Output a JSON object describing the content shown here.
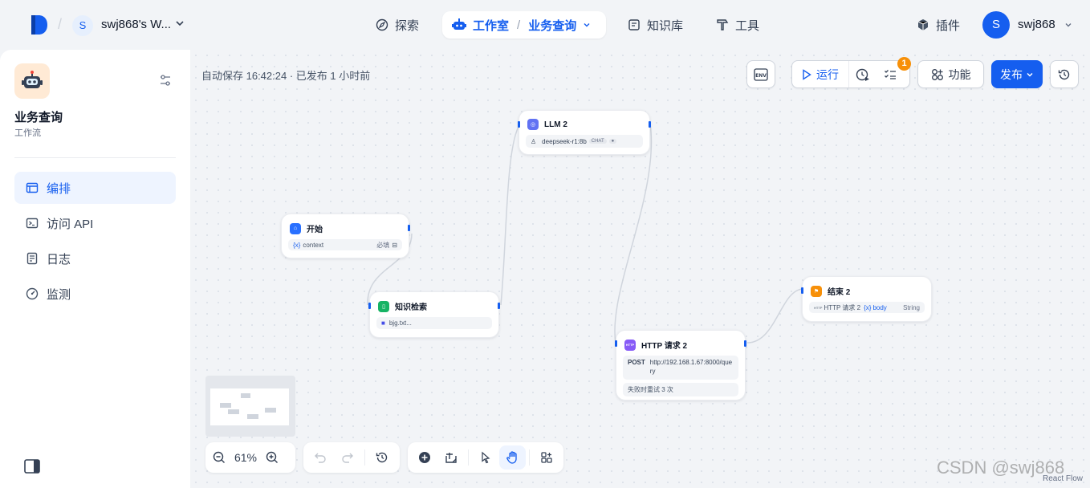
{
  "header": {
    "workspace_initial": "S",
    "workspace_name": "swj868's W...",
    "nav": {
      "explore": "探索",
      "studio": "工作室",
      "studio_sep": "/",
      "current_app": "业务查询",
      "knowledge": "知识库",
      "tools": "工具"
    },
    "plugin": "插件",
    "user_initial": "S",
    "user_name": "swj868"
  },
  "sidebar": {
    "app_name": "业务查询",
    "app_type": "工作流",
    "items": [
      {
        "label": "编排",
        "icon": "layout-icon",
        "active": true
      },
      {
        "label": "访问 API",
        "icon": "terminal-icon",
        "active": false
      },
      {
        "label": "日志",
        "icon": "log-icon",
        "active": false
      },
      {
        "label": "监测",
        "icon": "gauge-icon",
        "active": false
      }
    ]
  },
  "toolbar": {
    "autosave": "自动保存 16:42:24 · 已发布 1 小时前",
    "env": "ENV",
    "run": "运行",
    "checklist_badge": "1",
    "features": "功能",
    "publish": "发布"
  },
  "nodes": {
    "start": {
      "title": "开始",
      "var_icon": "{x}",
      "var": "context",
      "required": "必填"
    },
    "llm": {
      "title": "LLM 2",
      "model": "deepseek-r1:8b",
      "mode": "CHAT"
    },
    "knowledge": {
      "title": "知识检索",
      "dataset": "bjg.txt..."
    },
    "http": {
      "title": "HTTP 请求 2",
      "icon_text": "HTTP",
      "method": "POST",
      "url": "http://192.168.1.67:8000/query",
      "retry": "失败时重试 3 次"
    },
    "end": {
      "title": "结束 2",
      "src": "HTTP 请求 2",
      "var_icon": "{x}",
      "var": "body",
      "type": "String"
    }
  },
  "controls": {
    "zoom": "61%"
  },
  "watermark": "CSDN @swj868",
  "attribution": "React Flow",
  "colors": {
    "primary": "#155eef",
    "badge": "#f79009",
    "start_node": "#2970ff",
    "llm_node": "#6172f3",
    "knowledge_node": "#16b364",
    "http_node": "#875bf7",
    "end_node": "#f79009"
  }
}
